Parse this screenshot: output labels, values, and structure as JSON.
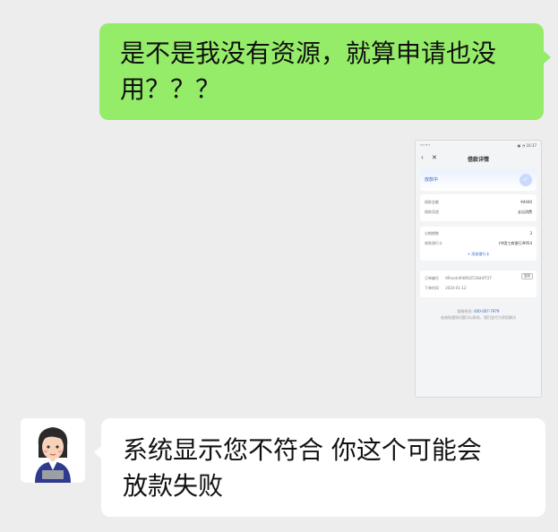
{
  "messages": {
    "outgoing": {
      "line1": "是不是我没有资源，就算申请也没",
      "line2": "用？？？"
    },
    "incoming": {
      "line1": "系统显示您不符合 你这个可能会",
      "line2": "放款失败"
    }
  },
  "screenshot": {
    "status_left": "ᵀᵃˡˡ ᵂ ⁶",
    "status_right": "▣ ◔ 16:37",
    "nav_title": "借款详情",
    "status_label": "放款中",
    "amount_label": "借款金额",
    "amount_value": "¥4440",
    "purpose_label": "借款用途",
    "purpose_value": "支出消费",
    "period_label": "分期期数",
    "period_value": "3",
    "card_label": "收款银行卡",
    "card_value": "(中国工商银行)9954",
    "add_card": "+ 添加银行卡",
    "order_label": "订单编号",
    "order_value": "9Rnxdrdfd8fd2518d4f727",
    "copy_label": "复制",
    "date_label": "下单时间",
    "date_value": "2024-01-12",
    "hotline_label": "客服热线:",
    "hotline_value": "400-007-7979",
    "foot_note": "若借款遇到问题可以联系，我们会尽力帮您解决"
  },
  "colors": {
    "outgoing_bubble": "#95ec69",
    "incoming_bubble": "#ffffff",
    "background": "#ededed"
  }
}
